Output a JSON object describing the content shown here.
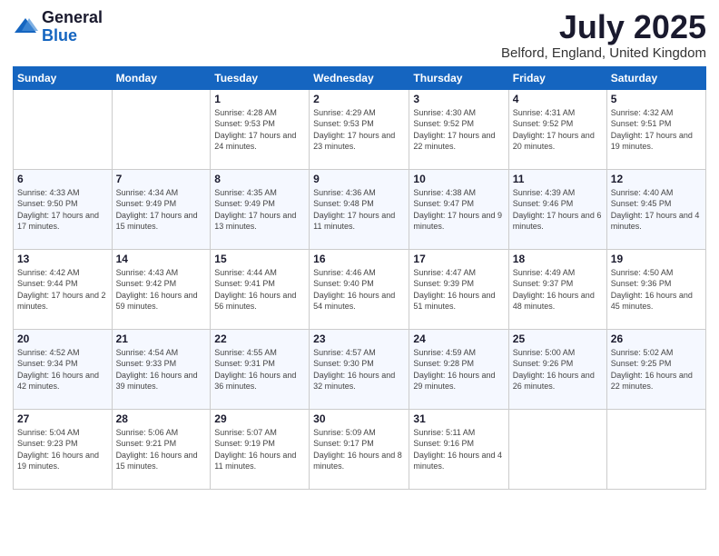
{
  "header": {
    "logo": {
      "line1": "General",
      "line2": "Blue"
    },
    "title": "July 2025",
    "location": "Belford, England, United Kingdom"
  },
  "weekdays": [
    "Sunday",
    "Monday",
    "Tuesday",
    "Wednesday",
    "Thursday",
    "Friday",
    "Saturday"
  ],
  "weeks": [
    [
      {
        "day": "",
        "info": ""
      },
      {
        "day": "",
        "info": ""
      },
      {
        "day": "1",
        "info": "Sunrise: 4:28 AM\nSunset: 9:53 PM\nDaylight: 17 hours and 24 minutes."
      },
      {
        "day": "2",
        "info": "Sunrise: 4:29 AM\nSunset: 9:53 PM\nDaylight: 17 hours and 23 minutes."
      },
      {
        "day": "3",
        "info": "Sunrise: 4:30 AM\nSunset: 9:52 PM\nDaylight: 17 hours and 22 minutes."
      },
      {
        "day": "4",
        "info": "Sunrise: 4:31 AM\nSunset: 9:52 PM\nDaylight: 17 hours and 20 minutes."
      },
      {
        "day": "5",
        "info": "Sunrise: 4:32 AM\nSunset: 9:51 PM\nDaylight: 17 hours and 19 minutes."
      }
    ],
    [
      {
        "day": "6",
        "info": "Sunrise: 4:33 AM\nSunset: 9:50 PM\nDaylight: 17 hours and 17 minutes."
      },
      {
        "day": "7",
        "info": "Sunrise: 4:34 AM\nSunset: 9:49 PM\nDaylight: 17 hours and 15 minutes."
      },
      {
        "day": "8",
        "info": "Sunrise: 4:35 AM\nSunset: 9:49 PM\nDaylight: 17 hours and 13 minutes."
      },
      {
        "day": "9",
        "info": "Sunrise: 4:36 AM\nSunset: 9:48 PM\nDaylight: 17 hours and 11 minutes."
      },
      {
        "day": "10",
        "info": "Sunrise: 4:38 AM\nSunset: 9:47 PM\nDaylight: 17 hours and 9 minutes."
      },
      {
        "day": "11",
        "info": "Sunrise: 4:39 AM\nSunset: 9:46 PM\nDaylight: 17 hours and 6 minutes."
      },
      {
        "day": "12",
        "info": "Sunrise: 4:40 AM\nSunset: 9:45 PM\nDaylight: 17 hours and 4 minutes."
      }
    ],
    [
      {
        "day": "13",
        "info": "Sunrise: 4:42 AM\nSunset: 9:44 PM\nDaylight: 17 hours and 2 minutes."
      },
      {
        "day": "14",
        "info": "Sunrise: 4:43 AM\nSunset: 9:42 PM\nDaylight: 16 hours and 59 minutes."
      },
      {
        "day": "15",
        "info": "Sunrise: 4:44 AM\nSunset: 9:41 PM\nDaylight: 16 hours and 56 minutes."
      },
      {
        "day": "16",
        "info": "Sunrise: 4:46 AM\nSunset: 9:40 PM\nDaylight: 16 hours and 54 minutes."
      },
      {
        "day": "17",
        "info": "Sunrise: 4:47 AM\nSunset: 9:39 PM\nDaylight: 16 hours and 51 minutes."
      },
      {
        "day": "18",
        "info": "Sunrise: 4:49 AM\nSunset: 9:37 PM\nDaylight: 16 hours and 48 minutes."
      },
      {
        "day": "19",
        "info": "Sunrise: 4:50 AM\nSunset: 9:36 PM\nDaylight: 16 hours and 45 minutes."
      }
    ],
    [
      {
        "day": "20",
        "info": "Sunrise: 4:52 AM\nSunset: 9:34 PM\nDaylight: 16 hours and 42 minutes."
      },
      {
        "day": "21",
        "info": "Sunrise: 4:54 AM\nSunset: 9:33 PM\nDaylight: 16 hours and 39 minutes."
      },
      {
        "day": "22",
        "info": "Sunrise: 4:55 AM\nSunset: 9:31 PM\nDaylight: 16 hours and 36 minutes."
      },
      {
        "day": "23",
        "info": "Sunrise: 4:57 AM\nSunset: 9:30 PM\nDaylight: 16 hours and 32 minutes."
      },
      {
        "day": "24",
        "info": "Sunrise: 4:59 AM\nSunset: 9:28 PM\nDaylight: 16 hours and 29 minutes."
      },
      {
        "day": "25",
        "info": "Sunrise: 5:00 AM\nSunset: 9:26 PM\nDaylight: 16 hours and 26 minutes."
      },
      {
        "day": "26",
        "info": "Sunrise: 5:02 AM\nSunset: 9:25 PM\nDaylight: 16 hours and 22 minutes."
      }
    ],
    [
      {
        "day": "27",
        "info": "Sunrise: 5:04 AM\nSunset: 9:23 PM\nDaylight: 16 hours and 19 minutes."
      },
      {
        "day": "28",
        "info": "Sunrise: 5:06 AM\nSunset: 9:21 PM\nDaylight: 16 hours and 15 minutes."
      },
      {
        "day": "29",
        "info": "Sunrise: 5:07 AM\nSunset: 9:19 PM\nDaylight: 16 hours and 11 minutes."
      },
      {
        "day": "30",
        "info": "Sunrise: 5:09 AM\nSunset: 9:17 PM\nDaylight: 16 hours and 8 minutes."
      },
      {
        "day": "31",
        "info": "Sunrise: 5:11 AM\nSunset: 9:16 PM\nDaylight: 16 hours and 4 minutes."
      },
      {
        "day": "",
        "info": ""
      },
      {
        "day": "",
        "info": ""
      }
    ]
  ]
}
